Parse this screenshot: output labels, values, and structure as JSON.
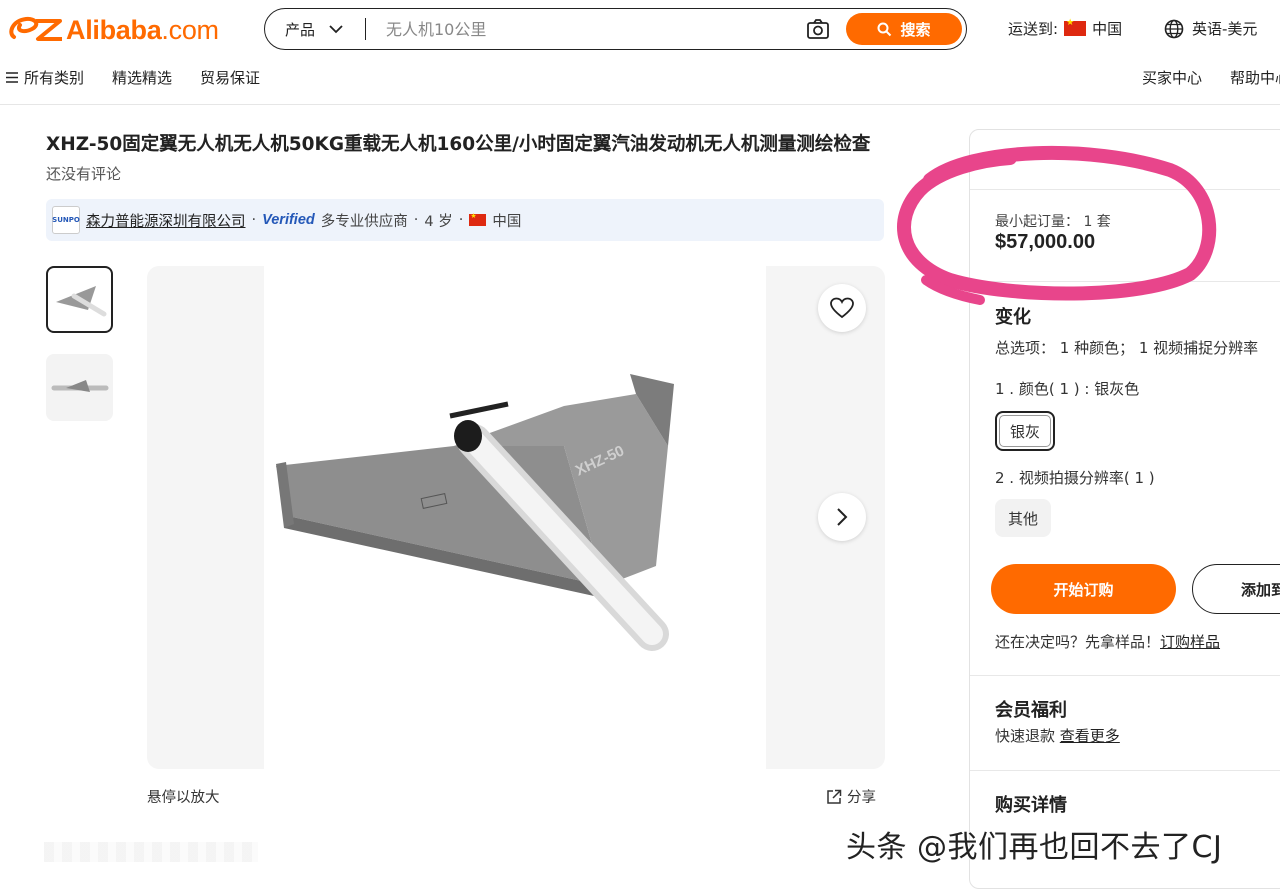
{
  "header": {
    "logo_text": "Alibaba",
    "logo_suffix": ".com",
    "search_category": "产品",
    "search_placeholder": "无人机10公里",
    "search_button": "搜索",
    "ship_to_label": "运送到:",
    "ship_to_country": "中国",
    "language": "英语-美元"
  },
  "nav": {
    "items": [
      "所有类别",
      "精选精选",
      "贸易保证"
    ],
    "right": [
      "买家中心",
      "帮助中心"
    ]
  },
  "product": {
    "title": "XHZ-50固定翼无人机无人机50KG重载无人机160公里/小时固定翼汽油发动机无人机测量测绘检查",
    "reviews": "还没有评论",
    "supplier_name": "森力普能源深圳有限公司",
    "supplier_verified": "Verified",
    "supplier_type": "多专业供应商",
    "supplier_years": "4 岁",
    "supplier_country": "中国",
    "supplier_logo_text": "SUNPO",
    "image_label": "XHZ-50",
    "hover_zoom": "悬停以放大",
    "share": "分享"
  },
  "panel": {
    "moq": "最小起订量： 1 套",
    "price": "$57,000.00",
    "variations_title": "变化",
    "variations_summary": "总选项： 1 种颜色； 1 视频捕捉分辨率",
    "color_label": "1 . 颜色( 1 ) : 银灰色",
    "color_option": "银灰",
    "resolution_label": "2 . 视频拍摄分辨率( 1 )",
    "resolution_option": "其他",
    "buy_button": "开始订购",
    "cart_button": "添加到",
    "sample_text": "还在决定吗？先拿样品！",
    "sample_link": "订购样品",
    "member_title": "会员福利",
    "member_text": "快速退款",
    "member_link": "查看更多",
    "purchase_title": "购买详情"
  },
  "watermark": "头条 @我们再也回不去了CJ",
  "colors": {
    "accent": "#ff6a00",
    "annotation": "#e8458b",
    "verified": "#2458b8"
  }
}
